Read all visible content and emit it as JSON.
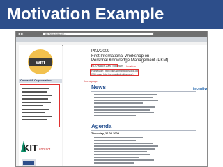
{
  "slide": {
    "title": "Motivation Example"
  },
  "browser": {
    "url": "http://www.gesia.org/...",
    "nav": "◀ ▶"
  },
  "tabs": "Home  Call  Dates  Program  Submission  Committee  Organizers  Contact",
  "page": {
    "heading_line1": "PKM2009",
    "heading_line2": "First International Workshop on",
    "heading_line3": "Personal Knowledge Management (PKM)",
    "date_line": "25-27 March 2009, Solothurn",
    "home_line": "Homepage: http://pkm.semanticdesktop.org",
    "wiki_line": "Wiki page: http://semanticdesktop.org/..."
  },
  "labels": {
    "location": "location",
    "homepage": "homepage",
    "contact": "contact",
    "contact_header": "Contact & Organisation",
    "news": "News",
    "agenda": "Agenda",
    "day": "Thursday, 26.03.2009",
    "kit": "KIT",
    "partner_logo": "incentive"
  },
  "annotation_color": "#e03030",
  "accent": "#2d4e8a"
}
